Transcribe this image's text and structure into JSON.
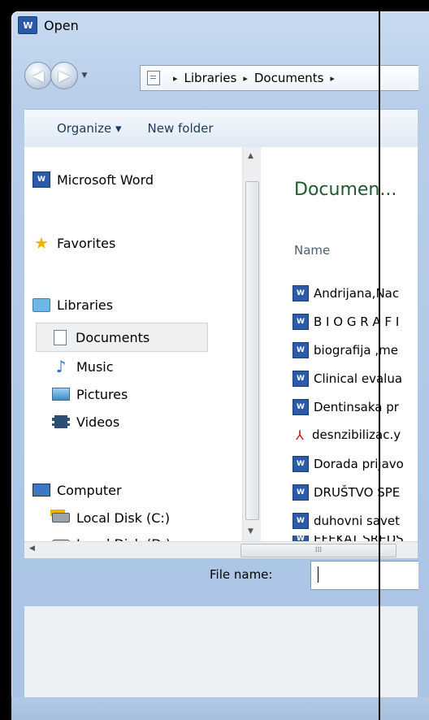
{
  "window": {
    "title": "Open",
    "app_icon": "W"
  },
  "navigation": {
    "back_icon": "back-arrow",
    "forward_icon": "forward-arrow"
  },
  "address": {
    "crumbs": [
      "Libraries",
      "Documents"
    ],
    "separator": "▸"
  },
  "toolbar": {
    "organize": "Organize ▾",
    "new_folder": "New folder"
  },
  "sidebar": {
    "items": [
      {
        "label": "Microsoft Word",
        "icon": "word-icon"
      },
      {
        "label": "Favorites",
        "icon": "star-icon"
      },
      {
        "label": "Libraries",
        "icon": "libraries-folder-icon"
      },
      {
        "label": "Documents",
        "icon": "documents-icon",
        "selected": true
      },
      {
        "label": "Music",
        "icon": "music-icon"
      },
      {
        "label": "Pictures",
        "icon": "pictures-icon"
      },
      {
        "label": "Videos",
        "icon": "videos-icon"
      },
      {
        "label": "Computer",
        "icon": "computer-icon"
      },
      {
        "label": "Local Disk (C:)",
        "icon": "system-disk-icon"
      },
      {
        "label": "Local Disk (D:)",
        "icon": "disk-icon"
      }
    ]
  },
  "content": {
    "heading": "Documen...",
    "column_name": "Name",
    "files": [
      {
        "name": "Andrijana,Nac",
        "type": "word"
      },
      {
        "name": "B I O G R A F I",
        "type": "word"
      },
      {
        "name": "biografija ,me",
        "type": "word"
      },
      {
        "name": "Clinical evalua",
        "type": "word"
      },
      {
        "name": "Dentinsaka pr",
        "type": "word"
      },
      {
        "name": "desnzibilizac.y",
        "type": "pdf"
      },
      {
        "name": "Dorada prijavo",
        "type": "word"
      },
      {
        "name": "DRUŠTVO SPE",
        "type": "word"
      },
      {
        "name": "duhovni savet",
        "type": "word"
      },
      {
        "name": "EFEKAT SREDS",
        "type": "word"
      }
    ]
  },
  "filename": {
    "label": "File name:",
    "value": ""
  },
  "colors": {
    "frame": "#b7cde9",
    "heading": "#1e5a2e",
    "selection": "#eef0f2"
  }
}
